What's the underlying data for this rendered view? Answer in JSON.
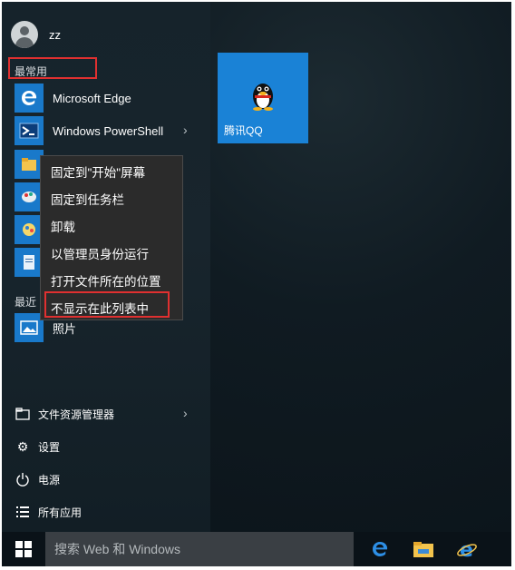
{
  "user": {
    "name": "zz",
    "avatar_icon": "user-avatar-icon"
  },
  "sections": {
    "most_used": "最常用",
    "recent": "最近"
  },
  "most_used_apps": [
    {
      "label": "Microsoft Edge",
      "icon": "edge-icon",
      "color": "#1979ca"
    },
    {
      "label": "Windows PowerShell",
      "icon": "powershell-icon",
      "color": "#1979ca",
      "has_submenu": true
    },
    {
      "label": "",
      "icon": "file-explorer-icon",
      "color": "#1979ca"
    },
    {
      "label": "",
      "icon": "paint-icon",
      "color": "#1979ca"
    },
    {
      "label": "",
      "icon": "color-picker-icon",
      "color": "#1979ca"
    },
    {
      "label": "",
      "icon": "notepad-icon",
      "color": "#1979ca"
    }
  ],
  "recent_apps": [
    {
      "label": "照片",
      "icon": "photos-icon",
      "color": "#1979ca"
    }
  ],
  "context_menu": {
    "items": [
      "固定到\"开始\"屏幕",
      "固定到任务栏",
      "卸载",
      "以管理员身份运行",
      "打开文件所在的位置",
      "不显示在此列表中"
    ],
    "highlighted_index": 5
  },
  "bottom_items": [
    {
      "label": "文件资源管理器",
      "icon": "file-explorer-icon",
      "has_submenu": true
    },
    {
      "label": "设置",
      "icon": "gear-icon"
    },
    {
      "label": "电源",
      "icon": "power-icon"
    },
    {
      "label": "所有应用",
      "icon": "all-apps-icon"
    }
  ],
  "tiles": [
    {
      "label": "腾讯QQ",
      "icon": "qq-penguin-icon",
      "color": "#1a82d6"
    }
  ],
  "taskbar": {
    "search_placeholder": "搜索 Web 和 Windows",
    "pinned": [
      {
        "name": "edge-icon"
      },
      {
        "name": "file-explorer-icon"
      },
      {
        "name": "internet-explorer-icon"
      }
    ]
  },
  "colors": {
    "accent": "#1979ca",
    "highlight_border": "#e03030",
    "tile_blue": "#1a82d6"
  }
}
